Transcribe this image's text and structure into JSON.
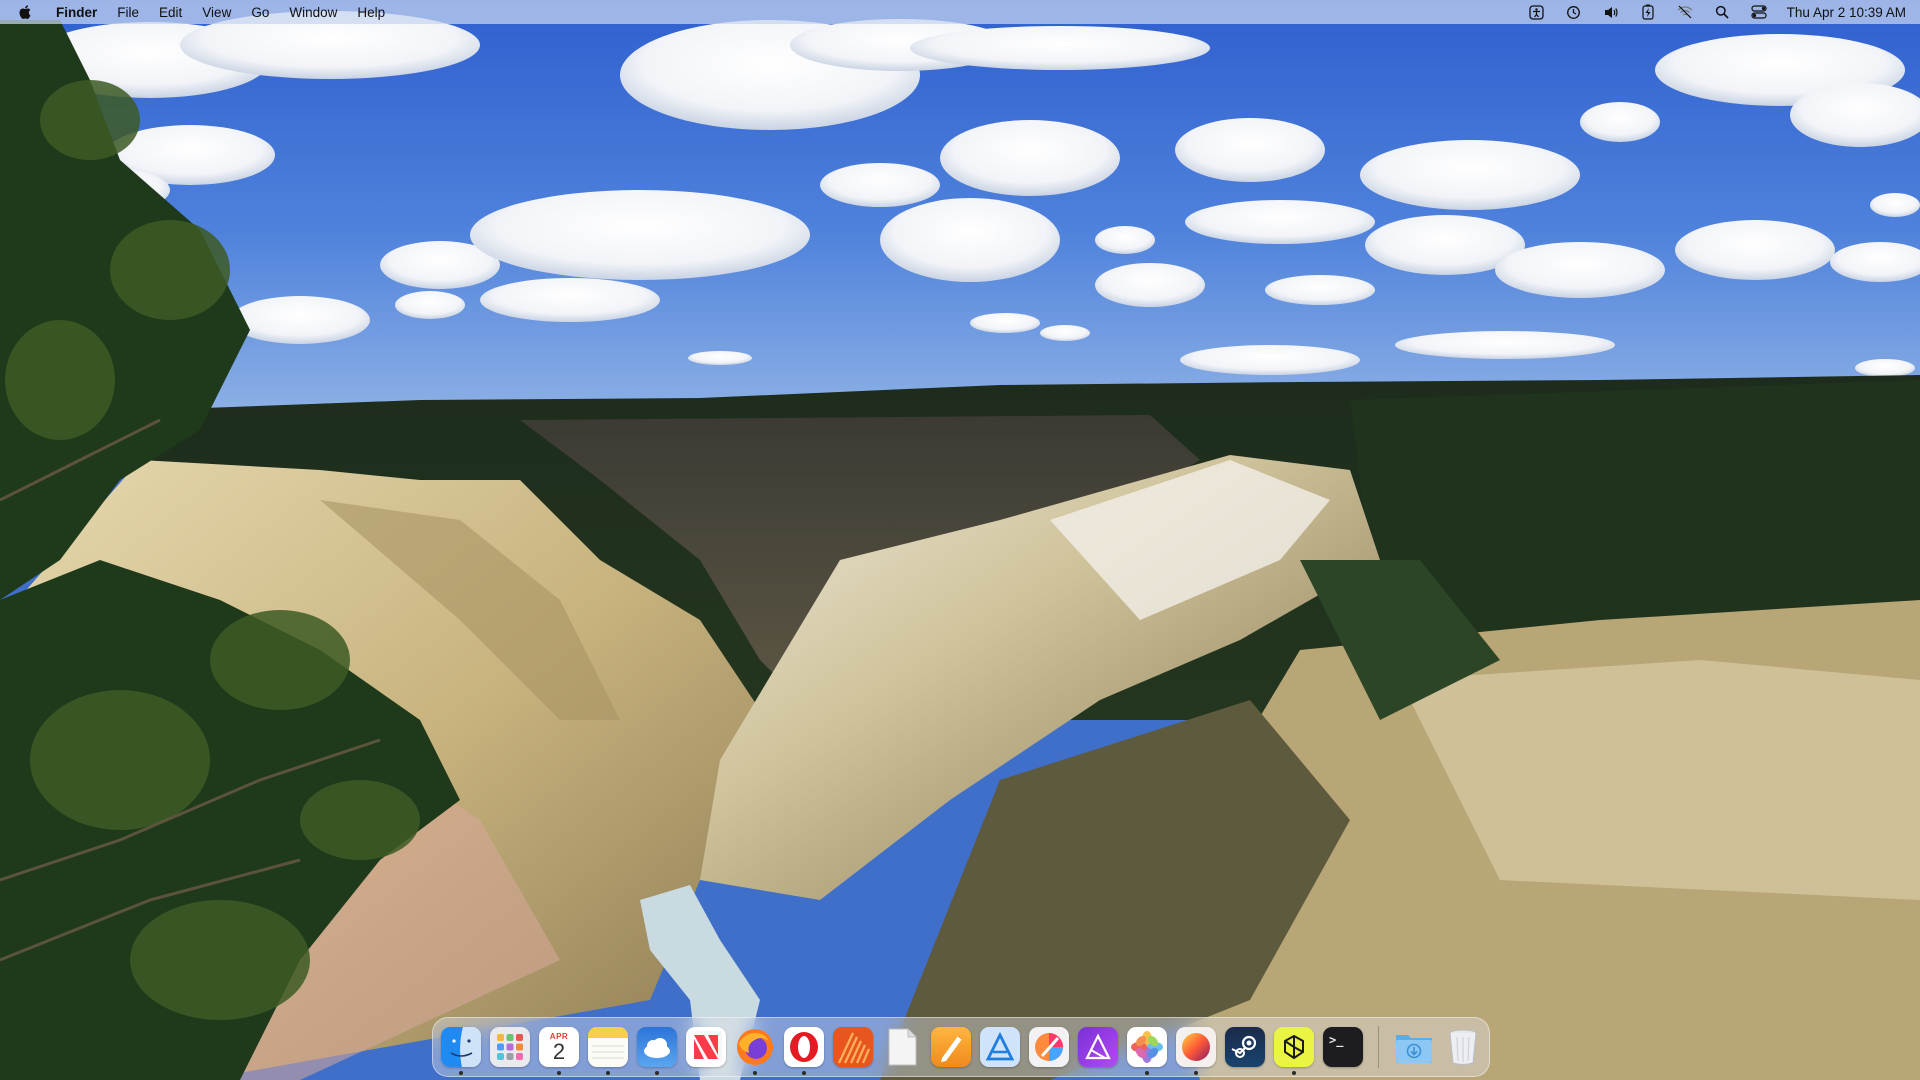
{
  "menubar": {
    "apple_icon": "apple-logo-icon",
    "app_name": "Finder",
    "menus": [
      "File",
      "Edit",
      "View",
      "Go",
      "Window",
      "Help"
    ],
    "status_icons": [
      "accessibility-icon",
      "time-machine-icon",
      "volume-icon",
      "battery-charging-icon",
      "wifi-off-icon",
      "spotlight-search-icon",
      "control-center-icon"
    ],
    "clock": "Thu Apr 2  10:39 AM"
  },
  "dock": {
    "calendar": {
      "month": "APR",
      "day": "2"
    },
    "terminal_prompt": ">_",
    "apps": [
      {
        "name": "Finder",
        "icon": "finder-icon",
        "running": true
      },
      {
        "name": "Launchpad",
        "icon": "launchpad-icon",
        "running": false
      },
      {
        "name": "Calendar",
        "icon": "calendar-icon",
        "running": true
      },
      {
        "name": "Notes",
        "icon": "notes-icon",
        "running": true
      },
      {
        "name": "Weather",
        "icon": "weather-icon",
        "running": true
      },
      {
        "name": "News",
        "icon": "news-icon",
        "running": false
      },
      {
        "name": "Firefox",
        "icon": "firefox-icon",
        "running": true
      },
      {
        "name": "Opera",
        "icon": "opera-icon",
        "running": true
      },
      {
        "name": "Sublime-like App",
        "icon": "orange-stripes-app-icon",
        "running": false
      },
      {
        "name": "TextEdit",
        "icon": "document-icon",
        "running": false
      },
      {
        "name": "Pages",
        "icon": "pages-icon",
        "running": false
      },
      {
        "name": "Xcode Instruments",
        "icon": "blue-a-app-icon",
        "running": false
      },
      {
        "name": "Pixelmator",
        "icon": "pixelmator-icon",
        "running": false
      },
      {
        "name": "Affinity",
        "icon": "affinity-icon",
        "running": false
      },
      {
        "name": "Photos",
        "icon": "photos-icon",
        "running": true
      },
      {
        "name": "Firefox Nightly",
        "icon": "gradient-circle-icon",
        "running": true
      },
      {
        "name": "Steam",
        "icon": "steam-icon",
        "running": false
      },
      {
        "name": "ChatGPT",
        "icon": "chatgpt-icon",
        "running": true
      },
      {
        "name": "Terminal",
        "icon": "terminal-icon",
        "running": false
      }
    ],
    "folders": [
      {
        "name": "Downloads",
        "icon": "downloads-folder-icon",
        "running": false
      },
      {
        "name": "Trash",
        "icon": "trash-icon",
        "running": false
      }
    ]
  }
}
